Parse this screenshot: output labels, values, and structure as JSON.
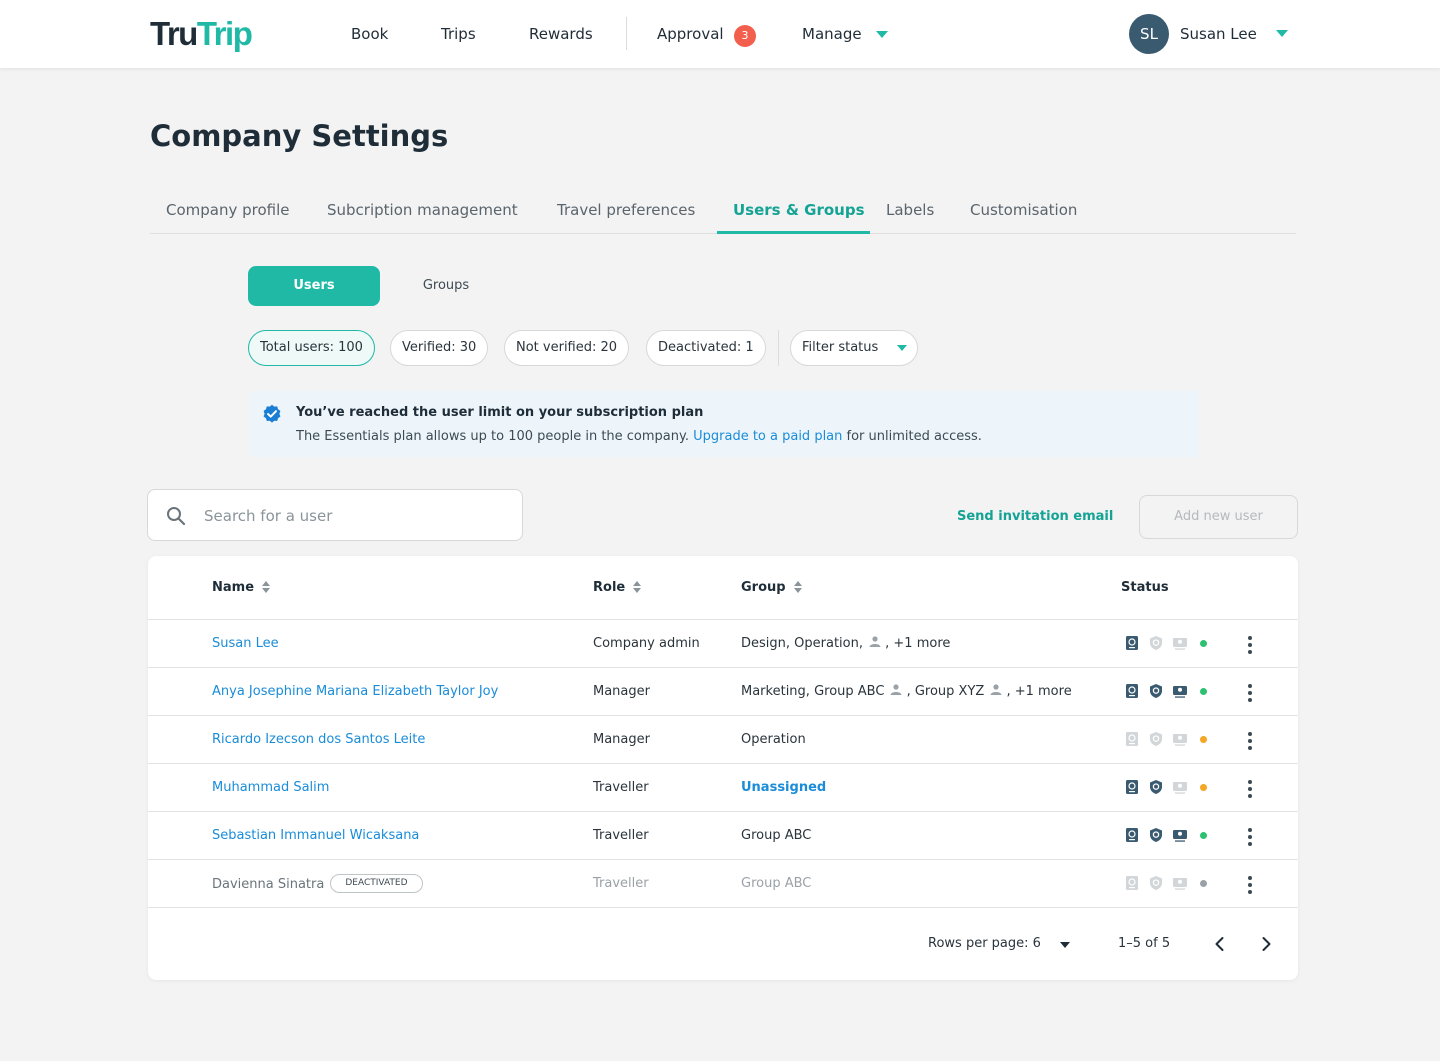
{
  "header": {
    "logo": {
      "part1": "Tru",
      "part2": "Trip"
    },
    "nav": {
      "book": "Book",
      "trips": "Trips",
      "rewards": "Rewards",
      "approval": "Approval",
      "approval_count": "3",
      "manage": "Manage"
    },
    "user": {
      "initials": "SL",
      "name": "Susan Lee"
    }
  },
  "page": {
    "title": "Company Settings"
  },
  "tabs": [
    {
      "label": "Company profile"
    },
    {
      "label": "Subcription management"
    },
    {
      "label": "Travel preferences"
    },
    {
      "label": "Users & Groups",
      "active": true
    },
    {
      "label": "Labels"
    },
    {
      "label": "Customisation"
    }
  ],
  "segment": {
    "users": "Users",
    "groups": "Groups"
  },
  "chips": {
    "total": "Total users: 100",
    "verified": "Verified: 30",
    "not_verified": "Not verified: 20",
    "deactivated": "Deactivated: 1",
    "filter": "Filter status"
  },
  "notice": {
    "title": "You’ve reached the user limit on your subscription plan",
    "body_before": "The Essentials plan allows up to 100 people in the company. ",
    "link": "Upgrade to a paid plan",
    "body_after": " for unlimited access."
  },
  "search": {
    "placeholder": "Search for a user"
  },
  "actions": {
    "send_invite": "Send invitation email",
    "add_user": "Add new user"
  },
  "table": {
    "columns": {
      "name": "Name",
      "role": "Role",
      "group": "Group",
      "status": "Status"
    },
    "rows": [
      {
        "name": "Susan Lee",
        "role": "Company admin",
        "group_a": "Design",
        "group_b": "Operation",
        "group_c": "",
        "more": "+1 more",
        "deactivated_label": "",
        "status": "active"
      },
      {
        "name": "Anya Josephine Mariana Elizabeth Taylor Joy",
        "role": "Manager",
        "group_a": "Marketing",
        "group_b": "Group ABC",
        "group_c": "Group XYZ",
        "more": "+1 more",
        "deactivated_label": "",
        "status": "active"
      },
      {
        "name": "Ricardo Izecson dos Santos Leite",
        "role": "Manager",
        "group_a": "Operation",
        "group_b": "",
        "group_c": "",
        "more": "",
        "deactivated_label": "",
        "status": "pending"
      },
      {
        "name": "Muhammad Salim",
        "role": "Traveller",
        "group_a": "Unassigned",
        "group_b": "",
        "group_c": "",
        "more": "",
        "deactivated_label": "",
        "status": "pending"
      },
      {
        "name": "Sebastian Immanuel Wicaksana",
        "role": "Traveller",
        "group_a": "Group ABC",
        "group_b": "",
        "group_c": "",
        "more": "",
        "deactivated_label": "",
        "status": "active"
      },
      {
        "name": "Davienna Sinatra",
        "role": "Traveller",
        "group_a": "Group ABC",
        "group_b": "",
        "group_c": "",
        "more": "",
        "deactivated_label": "DEACTIVATED",
        "status": "deactivated"
      }
    ]
  },
  "pagination": {
    "rows_per_page": "Rows per page: 6",
    "range": "1–5 of 5"
  },
  "colors": {
    "brand": "#1fb9a6",
    "link": "#1a8cd8",
    "badge": "#f2604d",
    "status_active": "#2fbf71",
    "status_pending": "#f5a623",
    "status_inactive": "#9aa2a8"
  },
  "icons": [
    "search-icon",
    "verified-check-icon",
    "passport-icon",
    "shield-icon",
    "id-card-icon",
    "person-icon",
    "chevron-left-icon",
    "chevron-right-icon",
    "caret-down-icon",
    "kebab-menu-icon"
  ]
}
